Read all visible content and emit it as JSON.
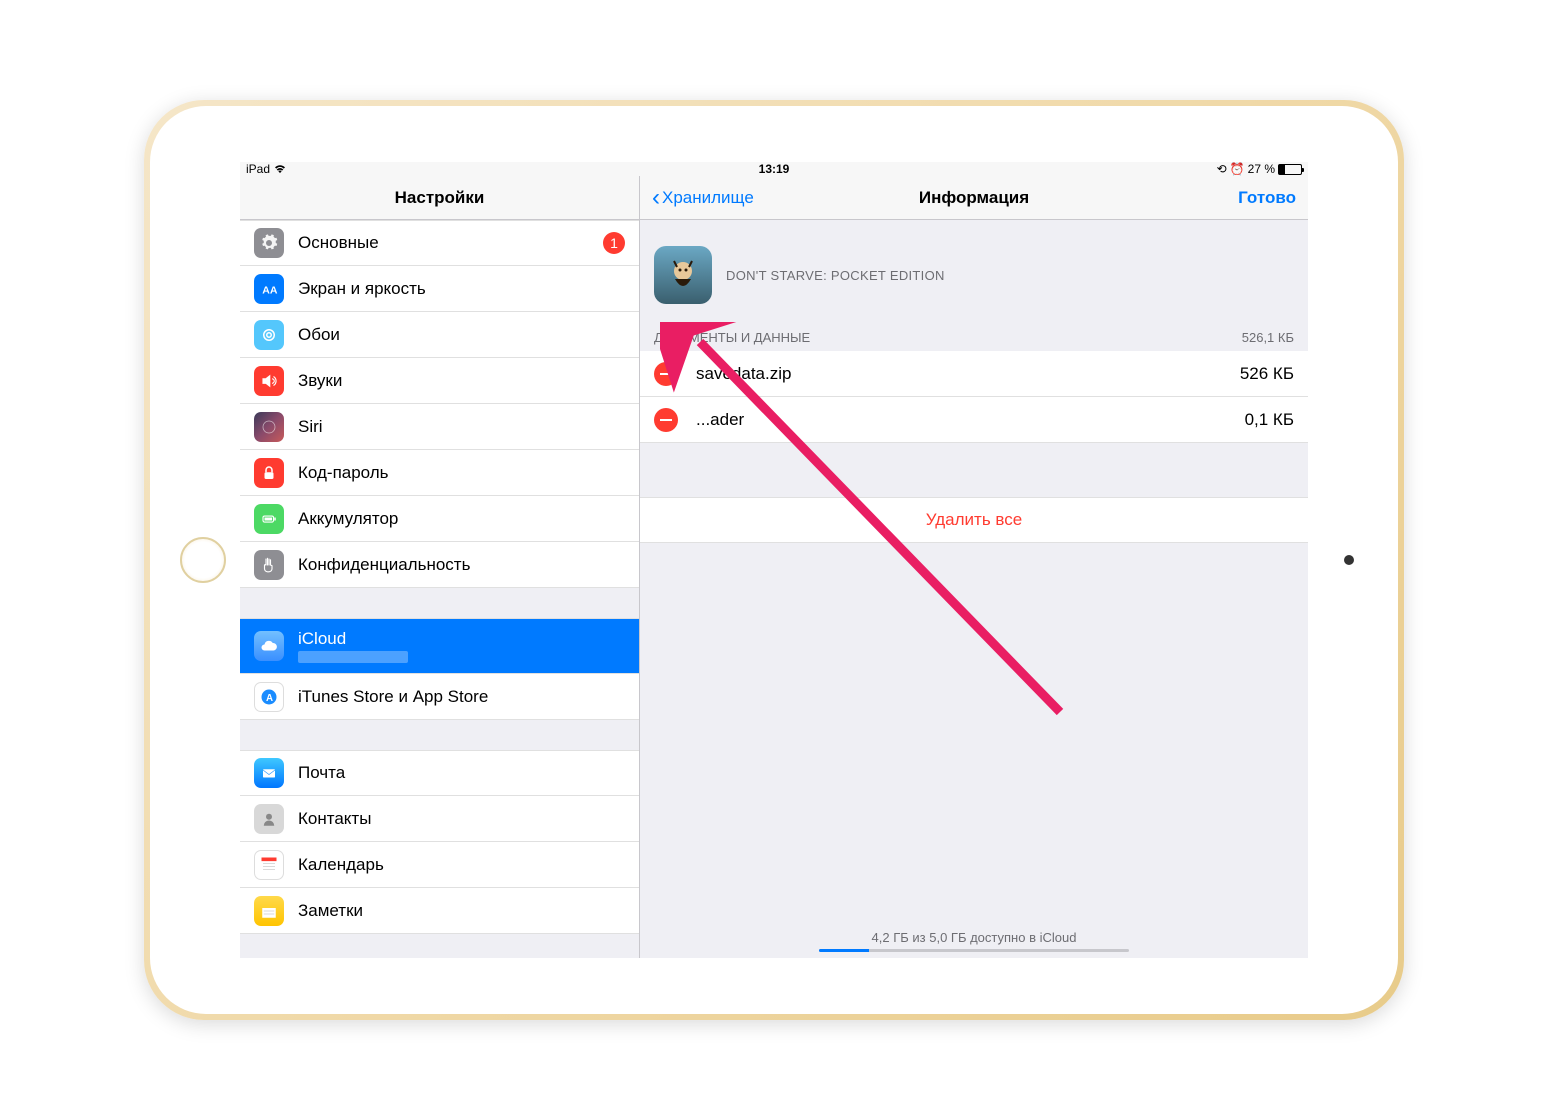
{
  "status": {
    "device": "iPad",
    "time": "13:19",
    "battery_percent": "27 %"
  },
  "sidebar": {
    "title": "Настройки",
    "groups": [
      [
        {
          "label": "Основные",
          "icon": "gear",
          "badge": "1"
        },
        {
          "label": "Экран и яркость",
          "icon": "display"
        },
        {
          "label": "Обои",
          "icon": "wallpaper"
        },
        {
          "label": "Звуки",
          "icon": "sounds"
        },
        {
          "label": "Siri",
          "icon": "siri"
        },
        {
          "label": "Код-пароль",
          "icon": "passcode"
        },
        {
          "label": "Аккумулятор",
          "icon": "battery"
        },
        {
          "label": "Конфиденциальность",
          "icon": "privacy"
        }
      ],
      [
        {
          "label": "iCloud",
          "icon": "icloud",
          "selected": true,
          "subtitle": " "
        },
        {
          "label": "iTunes Store и App Store",
          "icon": "appstore"
        }
      ],
      [
        {
          "label": "Почта",
          "icon": "mail"
        },
        {
          "label": "Контакты",
          "icon": "contacts"
        },
        {
          "label": "Календарь",
          "icon": "calendar"
        },
        {
          "label": "Заметки",
          "icon": "notes"
        }
      ]
    ]
  },
  "main": {
    "back_label": "Хранилище",
    "title": "Информация",
    "done_label": "Готово",
    "app_name": "DON'T STARVE: POCKET EDITION",
    "docs_header": "ДОКУМЕНТЫ И ДАННЫЕ",
    "docs_total": "526,1 КБ",
    "files": [
      {
        "name": "savedata.zip",
        "size": "526 КБ"
      },
      {
        "name": "...ader",
        "size": "0,1 КБ"
      }
    ],
    "delete_all": "Удалить все",
    "storage_text": "4,2 ГБ из 5,0 ГБ доступно в iCloud"
  }
}
